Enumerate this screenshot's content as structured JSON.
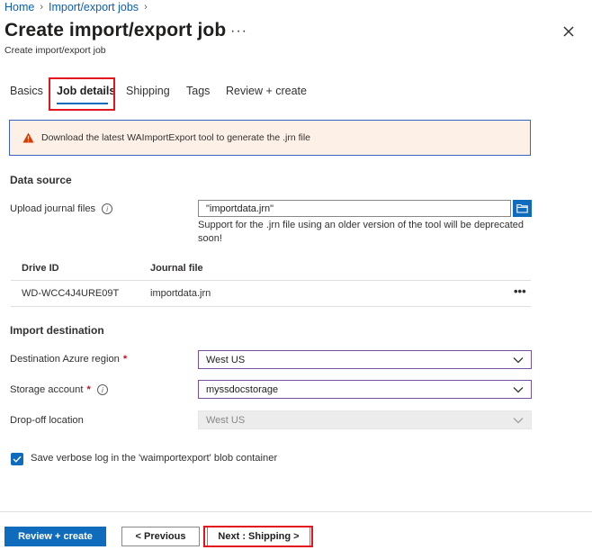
{
  "breadcrumb": {
    "items": [
      "Home",
      "Import/export jobs"
    ]
  },
  "header": {
    "title": "Create import/export job",
    "subtitle": "Create import/export job",
    "more_label": "···"
  },
  "tabs": [
    {
      "label": "Basics",
      "active": false
    },
    {
      "label": "Job details",
      "active": true
    },
    {
      "label": "Shipping",
      "active": false
    },
    {
      "label": "Tags",
      "active": false
    },
    {
      "label": "Review + create",
      "active": false
    }
  ],
  "warning": {
    "text": "Download the latest WAImportExport tool to generate the .jrn file",
    "icon": "warning-icon",
    "color": "#d83b01"
  },
  "data_source": {
    "heading": "Data source",
    "upload_label": "Upload journal files",
    "upload_value": "\"importdata.jrn\"",
    "note_line1": "Support for the .jrn file using an older version of the tool will be deprecated",
    "note_line2": "soon!",
    "table": {
      "columns": [
        "Drive ID",
        "Journal file"
      ],
      "rows": [
        {
          "drive_id": "WD-WCC4J4URE09T",
          "journal_file": "importdata.jrn",
          "more": "•••"
        }
      ]
    }
  },
  "import_destination": {
    "heading": "Import destination",
    "region_label": "Destination Azure region",
    "region_value": "West US",
    "storage_label": "Storage account",
    "storage_value": "myssdocstorage",
    "dropoff_label": "Drop-off location",
    "dropoff_value": "West US",
    "required_mark": "*"
  },
  "verbose_log": {
    "label": "Save verbose log in the 'waimportexport' blob container",
    "checked": true
  },
  "footer": {
    "review_label": "Review + create",
    "previous_label": "< Previous",
    "next_label": "Next : Shipping >"
  },
  "colors": {
    "accent": "#0f6cbd",
    "highlight": "#e2161c",
    "link": "#0f5fb4"
  }
}
